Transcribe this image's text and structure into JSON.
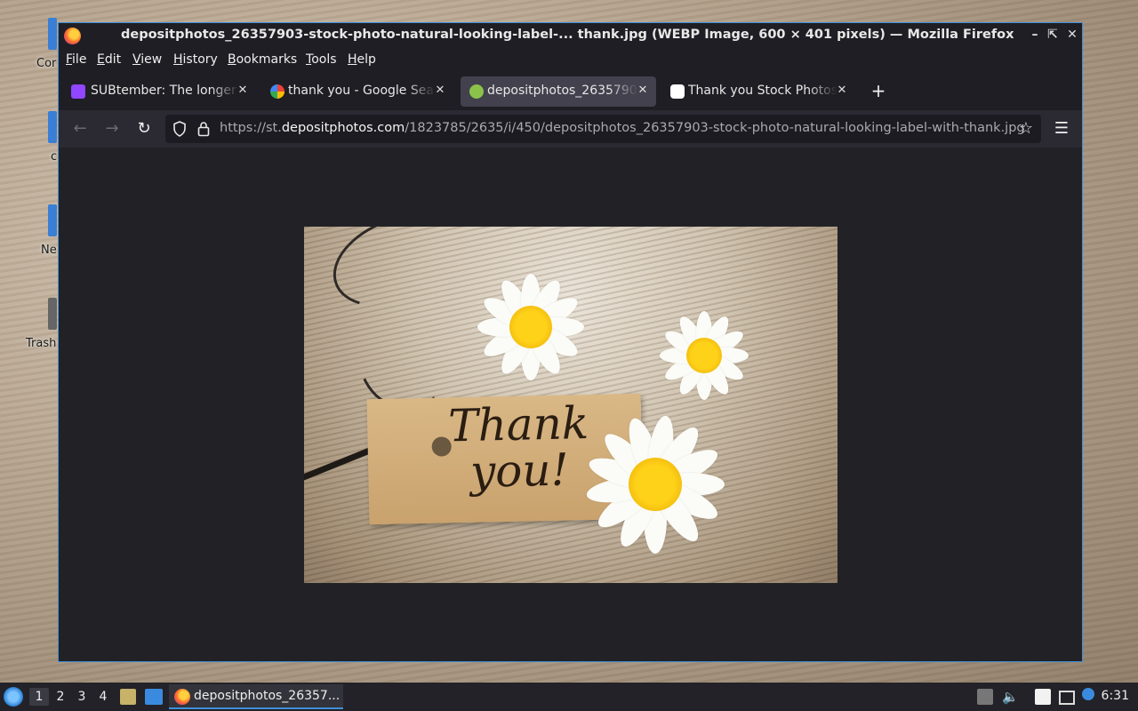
{
  "desktop": {
    "icons": [
      {
        "label": "Cor"
      },
      {
        "label": "c"
      },
      {
        "label": "Ne"
      },
      {
        "label": "Trash"
      }
    ]
  },
  "window": {
    "title": "depositphotos_26357903-stock-photo-natural-looking-label-... thank.jpg (WEBP Image, 600 × 401 pixels) — Mozilla Firefox"
  },
  "menu": {
    "items": [
      {
        "accel": "F",
        "rest": "ile"
      },
      {
        "accel": "E",
        "rest": "dit"
      },
      {
        "accel": "V",
        "rest": "iew"
      },
      {
        "accel": "H",
        "rest": "istory"
      },
      {
        "accel": "B",
        "rest": "ookmarks"
      },
      {
        "accel": "T",
        "rest": "ools"
      },
      {
        "accel": "H",
        "rest": "elp"
      }
    ]
  },
  "tabs": [
    {
      "label": "SUBtember: The longer t",
      "favicon": "twitch-icon",
      "color": "#9146ff",
      "active": false
    },
    {
      "label": "thank you - Google Searc",
      "favicon": "google-icon",
      "color": "#ffffff",
      "active": false
    },
    {
      "label": "depositphotos_2635790",
      "favicon": "depositphotos-icon",
      "color": "#8bc34a",
      "active": true
    },
    {
      "label": "Thank you Stock Photos,",
      "favicon": "tiktok-icon",
      "color": "#ffffff",
      "active": false
    }
  ],
  "nav": {
    "url_prefix": "https://st.",
    "url_domain": "depositphotos.com",
    "url_path": "/1823785/2635/i/450/depositphotos_26357903-stock-photo-natural-looking-label-with-thank.jpg"
  },
  "photo": {
    "tag_text_line1": "Thank",
    "tag_text_line2": "you!"
  },
  "taskbar": {
    "workspaces": [
      "1",
      "2",
      "3",
      "4"
    ],
    "active_workspace": "1",
    "task_label": "depositphotos_26357...",
    "clock": "6:31"
  }
}
